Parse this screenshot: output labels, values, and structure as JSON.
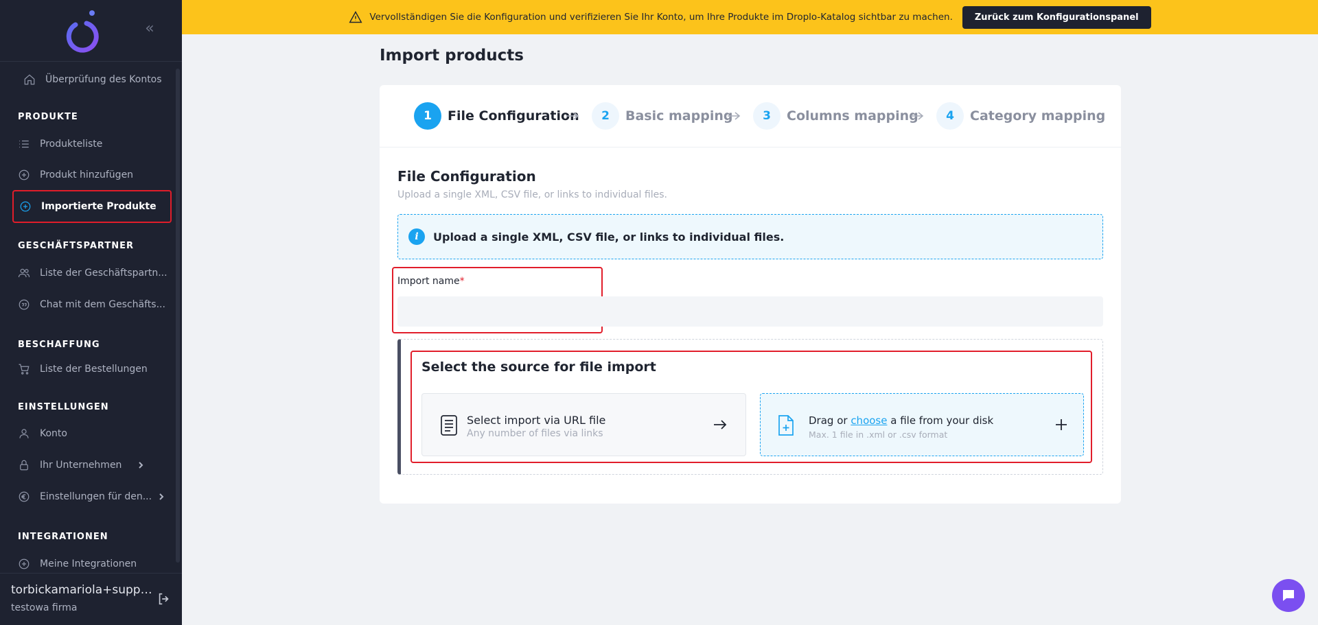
{
  "sidebar": {
    "collapse_icon": "double-chevron-left-icon",
    "items": [
      {
        "label": "Überprüfung des Kontos",
        "icon": "home-icon"
      },
      {
        "label": "Produkteliste",
        "icon": "list-icon"
      },
      {
        "label": "Produkt hinzufügen",
        "icon": "plus-circle-icon"
      },
      {
        "label": "Importierte Produkte",
        "icon": "plus-circle-icon"
      },
      {
        "label": "Liste der Geschäftspartn...",
        "icon": "users-icon"
      },
      {
        "label": "Chat mit dem Geschäfts...",
        "icon": "quote-chat-icon"
      },
      {
        "label": "Liste der Bestellungen",
        "icon": "cart-icon"
      },
      {
        "label": "Konto",
        "icon": "user-icon"
      },
      {
        "label": "Ihr Unternehmen",
        "icon": "lock-icon"
      },
      {
        "label": "Einstellungen für den...",
        "icon": "euro-icon"
      },
      {
        "label": "Meine Integrationen",
        "icon": "plus-circle-icon"
      }
    ],
    "sections": [
      "PRODUKTE",
      "GESCHÄFTSPARTNER",
      "BESCHAFFUNG",
      "EINSTELLUNGEN",
      "INTEGRATIONEN"
    ],
    "user": "torbickamariola+suppli...",
    "company": "testowa firma"
  },
  "banner": {
    "text": "Vervollständigen Sie die Konfiguration und verifizieren Sie Ihr Konto, um Ihre Produkte im Droplo-Katalog sichtbar zu machen.",
    "button": "Zurück zum Konfigurationspanel",
    "background": "#fcc31b"
  },
  "page": {
    "title": "Import products"
  },
  "steps": [
    {
      "num": "1",
      "label": "File Configuration"
    },
    {
      "num": "2",
      "label": "Basic mapping"
    },
    {
      "num": "3",
      "label": "Columns mapping"
    },
    {
      "num": "4",
      "label": "Category mapping"
    }
  ],
  "form": {
    "section_title": "File Configuration",
    "section_subtitle": "Upload a single XML, CSV file, or links to individual files.",
    "info_text": "Upload a single XML, CSV file, or links to individual files.",
    "import_name_label": "Import name",
    "required_mark": "*",
    "import_name_value": "",
    "source_title": "Select the source for file import",
    "url_option": {
      "title": "Select import via URL file",
      "subtitle": "Any number of files via links"
    },
    "file_option": {
      "prefix": "Drag or ",
      "link": "choose",
      "suffix": " a file from your disk",
      "subtitle": "Max. 1 file in .xml or .csv format"
    }
  },
  "colors": {
    "accent": "#1aa3f0",
    "sidebar": "#1e2230",
    "highlight": "#e11d2a",
    "chat": "#7b4ff0"
  }
}
